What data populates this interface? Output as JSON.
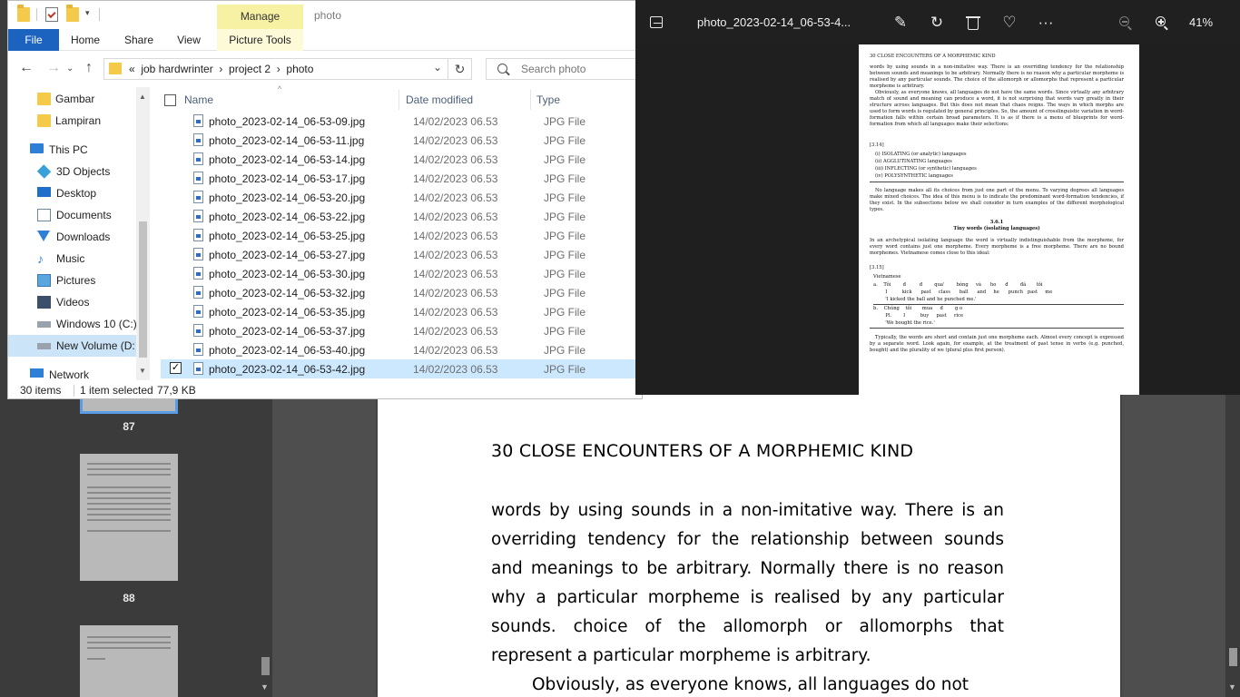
{
  "pdf_viewer": {
    "thumb_labels": [
      "87",
      "88"
    ],
    "doc_header": "30 CLOSE ENCOUNTERS OF A MORPHEMIC KIND",
    "doc_paragraphs": [
      "words by using sounds in a non-imitative way. There is an overriding tendency for the relationship between sounds and meanings to be arbitrary. Normally there is no reason why a particular morpheme is realised by any particular sounds. choice of the allomorph or allomorphs that represent a particular morpheme is arbitrary.",
      "Obviously, as everyone knows, all languages do not"
    ]
  },
  "explorer": {
    "manage_tab": "Manage",
    "window_title": "photo",
    "ribbon_tabs": [
      "File",
      "Home",
      "Share",
      "View",
      "Picture Tools"
    ],
    "address_path": "«  job hardwrinter  ›  project 2  ›  photo",
    "search_placeholder": "Search photo",
    "nav_items": [
      {
        "label": "Gambar",
        "icon": "folder-icon"
      },
      {
        "label": "Lampiran",
        "icon": "folder-icon"
      },
      {
        "label": "This PC",
        "icon": "computer-icon"
      },
      {
        "label": "3D Objects",
        "icon": "cube-icon"
      },
      {
        "label": "Desktop",
        "icon": "desktop-icon"
      },
      {
        "label": "Documents",
        "icon": "documents-icon"
      },
      {
        "label": "Downloads",
        "icon": "download-icon"
      },
      {
        "label": "Music",
        "icon": "music-icon"
      },
      {
        "label": "Pictures",
        "icon": "pictures-icon"
      },
      {
        "label": "Videos",
        "icon": "videos-icon"
      },
      {
        "label": "Windows 10 (C:)",
        "icon": "drive-icon"
      },
      {
        "label": "New Volume (D:",
        "icon": "drive-icon"
      },
      {
        "label": "Network",
        "icon": "network-icon"
      }
    ],
    "columns": [
      "Name",
      "Date modified",
      "Type"
    ],
    "files": [
      {
        "name": "photo_2023-02-14_06-53-09.jpg",
        "date": "14/02/2023 06.53",
        "type": "JPG File"
      },
      {
        "name": "photo_2023-02-14_06-53-11.jpg",
        "date": "14/02/2023 06.53",
        "type": "JPG File"
      },
      {
        "name": "photo_2023-02-14_06-53-14.jpg",
        "date": "14/02/2023 06.53",
        "type": "JPG File"
      },
      {
        "name": "photo_2023-02-14_06-53-17.jpg",
        "date": "14/02/2023 06.53",
        "type": "JPG File"
      },
      {
        "name": "photo_2023-02-14_06-53-20.jpg",
        "date": "14/02/2023 06.53",
        "type": "JPG File"
      },
      {
        "name": "photo_2023-02-14_06-53-22.jpg",
        "date": "14/02/2023 06.53",
        "type": "JPG File"
      },
      {
        "name": "photo_2023-02-14_06-53-25.jpg",
        "date": "14/02/2023 06.53",
        "type": "JPG File"
      },
      {
        "name": "photo_2023-02-14_06-53-27.jpg",
        "date": "14/02/2023 06.53",
        "type": "JPG File"
      },
      {
        "name": "photo_2023-02-14_06-53-30.jpg",
        "date": "14/02/2023 06.53",
        "type": "JPG File"
      },
      {
        "name": "photo_2023-02-14_06-53-32.jpg",
        "date": "14/02/2023 06.53",
        "type": "JPG File"
      },
      {
        "name": "photo_2023-02-14_06-53-35.jpg",
        "date": "14/02/2023 06.53",
        "type": "JPG File"
      },
      {
        "name": "photo_2023-02-14_06-53-37.jpg",
        "date": "14/02/2023 06.53",
        "type": "JPG File"
      },
      {
        "name": "photo_2023-02-14_06-53-40.jpg",
        "date": "14/02/2023 06.53",
        "type": "JPG File"
      },
      {
        "name": "photo_2023-02-14_06-53-42.jpg",
        "date": "14/02/2023 06.53",
        "type": "JPG File",
        "selected": true
      }
    ],
    "status": {
      "items": "30 items",
      "selected": "1 item selected",
      "size": "77,9 KB"
    }
  },
  "photo_viewer": {
    "title": "photo_2023-02-14_06-53-4...",
    "zoom": "41%",
    "page_header": "30    CLOSE ENCOUNTERS OF A MORPHEMIC KIND",
    "para1": "words by using sounds in a non-imitative way. There is an overriding tendency for the relationship between sounds and meanings to be arbitrary. Normally there is no reason why a particular morpheme is realised by any particular sounds. The choice of the allomorph or allomorphs that represent a particular morpheme is arbitrary.",
    "para2": "Obviously, as everyone knows, all languages do not have the same words. Since virtually any arbitrary match of sound and meaning can produce a word, it is not surprising that words vary greatly in their structure across languages. But this does not mean that chaos reigns. The ways in which morphs are used to form words is regulated by general principles. So, the amount of crosslinguistic variation in word-formation falls within certain broad parameters. It is as if there is a menu of blueprints for word-formation from which all languages make their selections:",
    "ex_ref1": "[3.14]",
    "ex_list": [
      "(i)  ISOLATING (or analytic) languages",
      "(ii)  AGGLUTINATING languages",
      "(iii)  INFLECTING (or synthetic) languages",
      "(iv)  POLYSYNTHETIC languages"
    ],
    "para3": "No language makes all its choices from just one part of the menu. To varying degrees all languages make mixed choices. The idea of this menu is to indicate the predominant word-formation tendencies, if they exist. In the subsections below we shall consider in turn examples of the different morphological types.",
    "sec_num": "3.6.1",
    "sec_title": "Tiny words (isolating languages)",
    "para4": "In an archetypical isolating language the word is virtually indistinguishable from the morpheme, for every word contains just one morpheme. Every morpheme is a free morpheme. There are no bound morphemes. Vietnamese comes close to this ideal:",
    "ex_ref2": "[3.15]",
    "ex_lang": "Vietnamese",
    "ex_a1": "a.    Tôi        đ         đ        qua'        bóng     và      ho      đ        đã       tôi",
    "ex_a2": "        I          kick      past     class      ball      and     he      punch   past     me",
    "ex_a3": "        'I kicked the ball and he punched me.'",
    "ex_b1": "b.    Chúng    tôi       mua     đ        g o",
    "ex_b2": "        Pl.        I          buy     past     rice",
    "ex_b3": "        'We bought the rice.'",
    "para5": "Typically, the words are short and contain just one morpheme each. Almost every concept is expressed by a separate word. Look again, for example, at the treatment of past tense in verbs (e.g. punched, bought) and the plurality of we (plural plus first person)."
  }
}
